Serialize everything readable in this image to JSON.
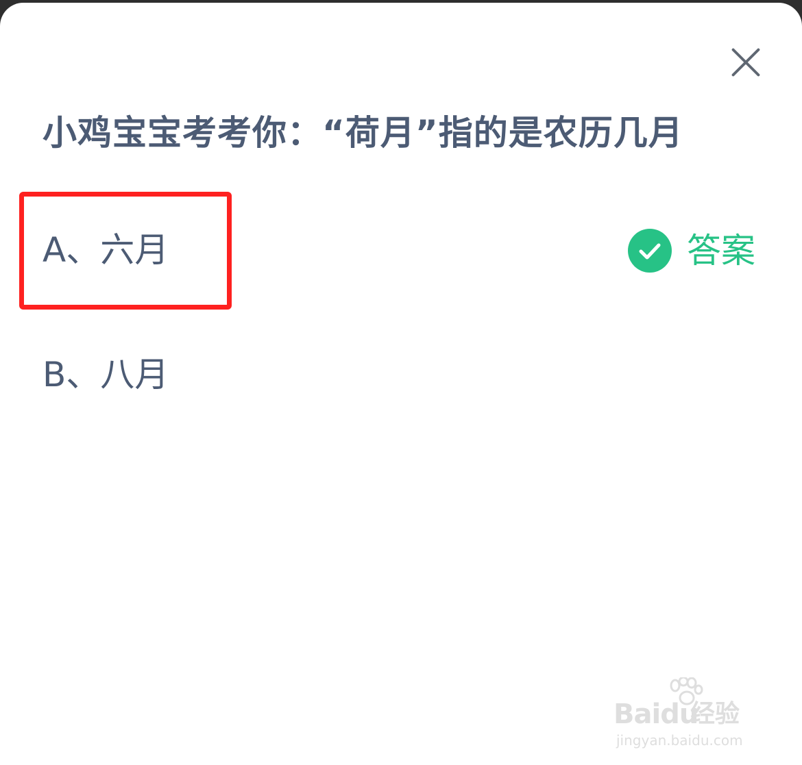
{
  "dialog": {
    "question": "小鸡宝宝考考你：“荷月”指的是农历几月",
    "close_icon": "close-icon"
  },
  "options": [
    {
      "label": "A、六月",
      "is_answer": true
    },
    {
      "label": "B、八月",
      "is_answer": false
    }
  ],
  "answer_badge": {
    "label": "答案",
    "icon": "check-circle-icon",
    "color": "#27c286"
  },
  "highlight": {
    "color": "#fe2120"
  },
  "watermark": {
    "brand": "Baidu",
    "sub": "经验",
    "url": "jingyan.baidu.com"
  },
  "colors": {
    "text": "#4c5b74",
    "accent_green": "#27c286",
    "highlight_red": "#fe2120"
  }
}
